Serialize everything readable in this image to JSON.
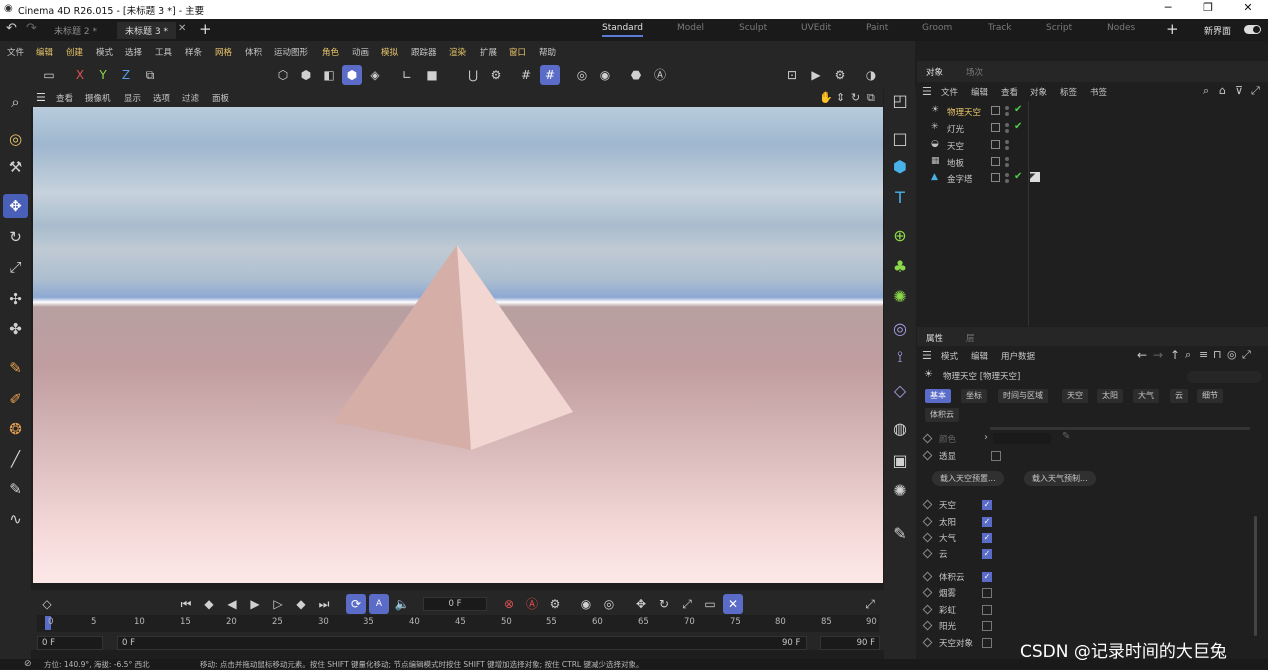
{
  "window": {
    "title": "Cinema 4D R26.015 - [未标题 3 *] - 主要",
    "minimize": "─",
    "maximize": "❐",
    "close": "✕"
  },
  "doc_tabs": [
    {
      "label": "未标题 2 *",
      "active": false
    },
    {
      "label": "未标题 3 *",
      "active": true
    }
  ],
  "layouts": [
    "Standard",
    "Model",
    "Sculpt",
    "UVEdit",
    "Paint",
    "Groom",
    "Track",
    "Script",
    "Nodes"
  ],
  "active_layout": "Standard",
  "new_ui_label": "新界面",
  "menu": [
    "文件",
    "编辑",
    "创建",
    "模式",
    "选择",
    "工具",
    "样条",
    "网格",
    "体积",
    "运动图形",
    "角色",
    "动画",
    "模拟",
    "跟踪器",
    "渲染",
    "扩展",
    "窗口",
    "帮助"
  ],
  "axes": {
    "x": "X",
    "y": "Y",
    "z": "Z"
  },
  "viewport_menu": [
    "查看",
    "摄像机",
    "显示",
    "选项",
    "过滤",
    "面板"
  ],
  "object_panel": {
    "tabs": [
      "对象",
      "场次"
    ],
    "menu": [
      "文件",
      "编辑",
      "查看",
      "对象",
      "标签",
      "书签"
    ],
    "objects": [
      {
        "name": "物理天空",
        "icon": "☀",
        "selected": true,
        "check": true
      },
      {
        "name": "灯光",
        "icon": "✳",
        "selected": false,
        "check": true
      },
      {
        "name": "天空",
        "icon": "◒",
        "selected": false,
        "check": false
      },
      {
        "name": "地板",
        "icon": "▦",
        "selected": false,
        "check": false
      },
      {
        "name": "金字塔",
        "icon": "▲",
        "selected": false,
        "check": true
      }
    ]
  },
  "attr_panel": {
    "tabs": [
      "属性",
      "层"
    ],
    "menu": [
      "模式",
      "编辑",
      "用户数据"
    ],
    "object_title": "物理天空 [物理天空]",
    "basic_tabs": [
      "基本",
      "坐标",
      "时间与区域",
      "天空",
      "太阳",
      "大气",
      "云",
      "细节"
    ],
    "volume_tab": "体积云",
    "color_label": "颜色",
    "transparent_label": "透显",
    "btn_preset": "载入天空预置...",
    "btn_atmo": "载入天气预制...",
    "props_checked": [
      "天空",
      "太阳",
      "大气",
      "云"
    ],
    "volume_cloud": "体积云",
    "props_unchecked": [
      "烟雾",
      "彩虹",
      "阳光",
      "天空对象"
    ]
  },
  "timeline": {
    "current_frame": "0 F",
    "ticks": [
      "0",
      "5",
      "10",
      "15",
      "20",
      "25",
      "30",
      "35",
      "40",
      "45",
      "50",
      "55",
      "60",
      "65",
      "70",
      "75",
      "80",
      "85",
      "90"
    ],
    "start_field": "0 F",
    "start_field2": "0 F",
    "end_field": "90 F",
    "end_field2": "90 F"
  },
  "status": {
    "orientation": "方位: 140.9°, 海拔: -6.5° 西北",
    "hint": "移动: 点击并拖动鼠标移动元素。按住 SHIFT 键量化移动; 节点编辑模式时按住 SHIFT 键增加选择对象; 按住 CTRL 键减少选择对象。"
  },
  "watermark": "CSDN @记录时间的大巨兔",
  "colors": {
    "accent": "#5a6cc7",
    "selected_text": "#e8c56a",
    "check": "#4ccc4c"
  }
}
